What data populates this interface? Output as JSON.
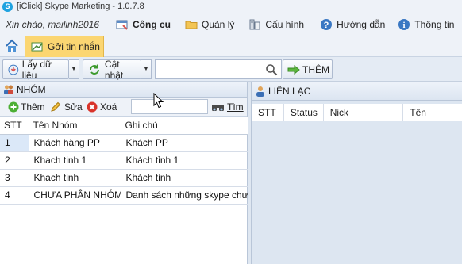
{
  "window": {
    "title": "[iClick] Skype Marketing - 1.0.7.8",
    "app_icon_letter": "S"
  },
  "menu": {
    "greeting": "Xin chào, mailinh2016",
    "items": [
      {
        "label": "Công cụ",
        "icon": "tools-icon"
      },
      {
        "label": "Quản lý",
        "icon": "folder-icon"
      },
      {
        "label": "Cấu hình",
        "icon": "config-icon"
      },
      {
        "label": "Hướng dẫn",
        "icon": "help-icon"
      },
      {
        "label": "Thông tin",
        "icon": "info-icon"
      }
    ]
  },
  "ribbon": {
    "send_tab_label": "Gởi tin nhắn"
  },
  "toolbar": {
    "fetch_label": "Lấy dữ liệu",
    "update_label": "Cật nhật",
    "search_value": "",
    "add_label": "THÊM"
  },
  "groups_panel": {
    "title": "NHÓM",
    "add_label": "Thêm",
    "edit_label": "Sửa",
    "delete_label": "Xoá",
    "search_value": "",
    "find_label": "Tìm",
    "columns": [
      "STT",
      "Tên Nhóm",
      "Ghi chú"
    ],
    "rows": [
      {
        "stt": "1",
        "name": "Khách hàng PP",
        "note": "Khách PP"
      },
      {
        "stt": "2",
        "name": "Khach tinh 1",
        "note": "Khách tỉnh 1"
      },
      {
        "stt": "3",
        "name": "Khach tinh",
        "note": "Khách tỉnh"
      },
      {
        "stt": "4",
        "name": "CHƯA PHÂN NHÓM",
        "note": "Danh sách những skype chưa"
      }
    ]
  },
  "contacts_panel": {
    "title": "LIÊN LẠC",
    "columns": [
      "STT",
      "Status",
      "Nick",
      "Tên"
    ]
  },
  "colors": {
    "accent_tab": "#fbd672",
    "selected_cell": "#dbe8f8",
    "panel_bg": "#dde6f1"
  }
}
